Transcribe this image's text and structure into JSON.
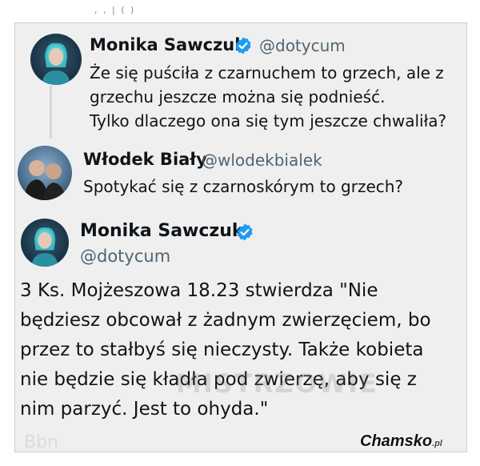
{
  "top_fragment": ", , | ( )",
  "tweets": [
    {
      "name": "Monika Sawczuk",
      "handle": "@dotycum",
      "verified": true,
      "avatar_icon": "avatar-photo",
      "text": "Że się puściła z czarnuchem to grzech, ale z\ngrzechu jeszcze można się podnieść.\nTylko dlaczego ona się tym jeszcze chwaliła?"
    },
    {
      "name": "Włodek Biały",
      "handle": "@wlodekbialek",
      "verified": false,
      "avatar_icon": "avatar-photo",
      "text": "Spotykać się z czarnoskórym to grzech?"
    }
  ],
  "main_tweet": {
    "name": "Monika Sawczuk",
    "handle": "@dotycum",
    "verified": true,
    "text": "3 Ks. Mojżeszowa 18.23 stwierdza \"Nie\nbędziesz obcował z żadnym zwierzęciem, bo\nprzez to stałbyś się  nieczysty. Także kobieta\nnie będzie się kładła pod zwierzę, aby się z\nnim parzyć. Jest to ohyda.\""
  },
  "watermarks": {
    "mistrzowie": "MISTRZOWIE",
    "faint": "Bbn",
    "chamsko": "Chamsko",
    "chamsko_suffix": ".pl"
  },
  "colors": {
    "verified_blue": "#1d9bf0",
    "handle_gray": "#536471",
    "text_dark": "#0f1419"
  }
}
